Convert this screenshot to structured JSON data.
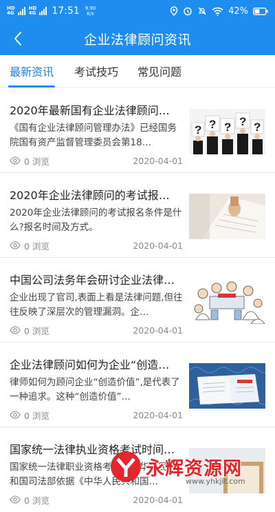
{
  "statusbar": {
    "signal1": "4G",
    "signal1_sup": "HD",
    "signal2": "4G",
    "signal2_sup": "HD",
    "time": "17:51",
    "speed_value": "9.90",
    "speed_unit": "K/s",
    "battery": "42%",
    "icons": [
      "location-icon",
      "alarm-icon",
      "mute-icon",
      "wifi-icon",
      "battery-icon"
    ]
  },
  "header": {
    "title": "企业法律顾问资讯",
    "back_icon": "chevron-left-icon"
  },
  "tabs": [
    {
      "label": "最新资讯",
      "active": true
    },
    {
      "label": "考试技巧",
      "active": false
    },
    {
      "label": "常见问题",
      "active": false
    }
  ],
  "articles": [
    {
      "title": "2020年最新国有企业法律顾问…",
      "summary": "《国有企业法律顾问管理办法》已经国务院国有资产监督管理委员会第18…",
      "views": "0 浏览",
      "date": "2020-04-01",
      "thumb": "question-marks-image"
    },
    {
      "title": "2020年企业法律顾问的考试报…",
      "summary": "2020年企业法律顾问的考试报名条件是什么?报名时间及方式。",
      "views": "0 浏览",
      "date": "2020-04-01",
      "thumb": "signing-document-image"
    },
    {
      "title": "中国公司法务年会研讨企业法律…",
      "summary": "企业出现了官司,表面上看是法律问题,但往往反映了深层次的管理漏洞。企…",
      "views": "0 浏览",
      "date": "2020-04-01",
      "thumb": "cartoon-meeting-image"
    },
    {
      "title": "企业法律顾问如何为企业“创造…",
      "summary": "律师如何为顾问企业“创造价值”,是代表了一种追求。这种“创造价值”…",
      "views": "0 浏览",
      "date": "2020-04-01",
      "thumb": "book-on-desk-image"
    },
    {
      "title": "国家统一法律执业资格考试时间…",
      "summary": "国家统一法律职业资格考试由中华人民共和国司法部依据《中华人民共和国…",
      "views": "0 浏览",
      "date": "2020-04-01",
      "thumb": "law-book-image"
    }
  ],
  "watermark": {
    "text": "永辉资源网",
    "url": "www.yhkjit.com"
  }
}
